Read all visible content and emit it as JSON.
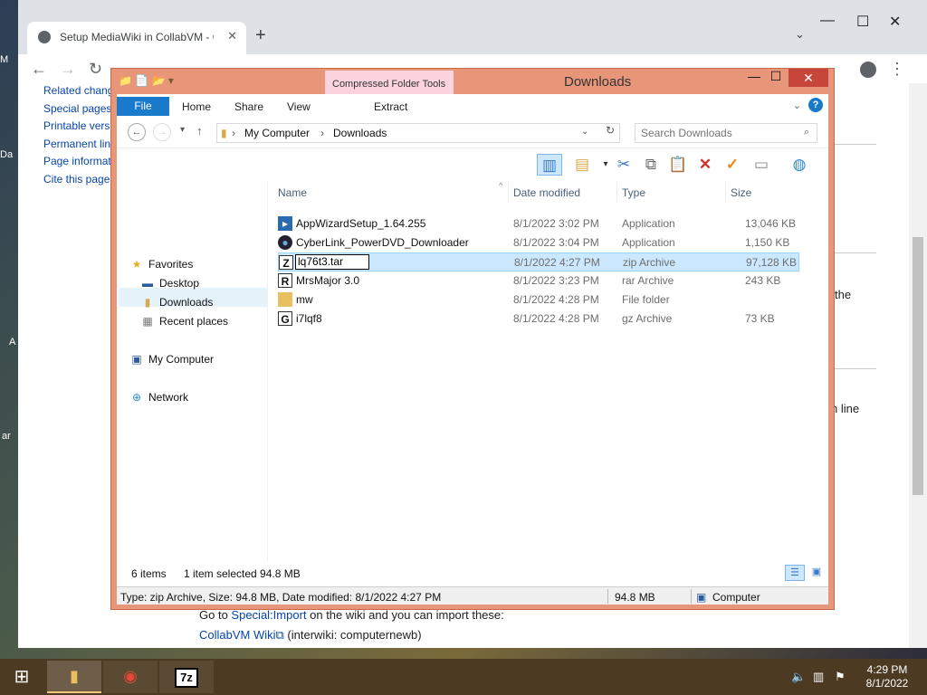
{
  "desktop": {
    "fragments": [
      "M",
      "Da",
      "A",
      "ar"
    ]
  },
  "chrome": {
    "tab_title": "Setup MediaWiki in CollabVM - C",
    "tab_close": "✕",
    "new_tab": "+",
    "tab_dropdown": "⌄",
    "win_minimize": "—",
    "win_maximize": "☐",
    "win_close": "✕",
    "nav_back": "←",
    "nav_forward": "→",
    "nav_reload": "↻",
    "sidebar_links": [
      "Related chang",
      "Special pages",
      "Printable vers",
      "Permanent lin",
      "Page informat",
      "Cite this page"
    ],
    "page_fragments": {
      "right1": "the",
      "right2": "n line"
    },
    "bottom_line1_pre": "Go to ",
    "bottom_line1_link": "Special:Import",
    "bottom_line1_post": " on the wiki and you can import these:",
    "bottom_line2_link": "CollabVM Wiki",
    "bottom_line2_post": " (interwiki: computernewb)"
  },
  "explorer": {
    "title": "Downloads",
    "context_tab": "Compressed Folder Tools",
    "ribbon": {
      "file": "File",
      "home": "Home",
      "share": "Share",
      "view": "View",
      "extract": "Extract"
    },
    "help": "?",
    "address": {
      "root": "My Computer",
      "sep": "›",
      "folder": "Downloads"
    },
    "search_placeholder": "Search Downloads",
    "nav": {
      "favorites": "Favorites",
      "desktop": "Desktop",
      "downloads": "Downloads",
      "recent": "Recent places",
      "computer": "My Computer",
      "network": "Network"
    },
    "columns": {
      "name": "Name",
      "date": "Date modified",
      "type": "Type",
      "size": "Size"
    },
    "files": [
      {
        "name": "AppWizardSetup_1.64.255",
        "date": "8/1/2022 3:02 PM",
        "type": "Application",
        "size": "13,046 KB"
      },
      {
        "name": "CyberLink_PowerDVD_Downloader",
        "date": "8/1/2022 3:04 PM",
        "type": "Application",
        "size": "1,150 KB"
      },
      {
        "name": "lq76t3.tar",
        "date": "8/1/2022 4:27 PM",
        "type": "zip Archive",
        "size": "97,128 KB"
      },
      {
        "name": "MrsMajor 3.0",
        "date": "8/1/2022 3:23 PM",
        "type": "rar Archive",
        "size": "243 KB"
      },
      {
        "name": "mw",
        "date": "8/1/2022 4:28 PM",
        "type": "File folder",
        "size": ""
      },
      {
        "name": "i7lqf8",
        "date": "8/1/2022 4:28 PM",
        "type": "gz Archive",
        "size": "73 KB"
      }
    ],
    "status": {
      "items": "6 items",
      "selected": "1 item selected  94.8 MB"
    },
    "details_bar": {
      "info": "Type: zip Archive, Size: 94.8 MB, Date modified: 8/1/2022 4:27 PM",
      "size": "94.8 MB",
      "location": "Computer"
    }
  },
  "taskbar": {
    "time": "4:29 PM",
    "date": "8/1/2022",
    "sevenzip": "7z"
  }
}
